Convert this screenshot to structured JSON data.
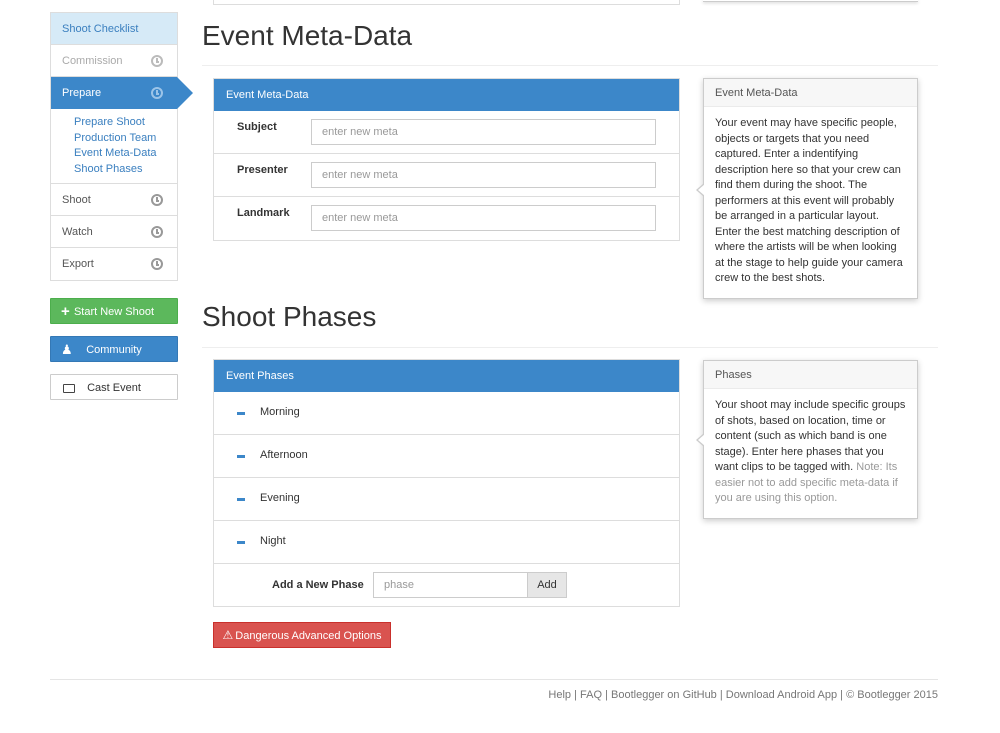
{
  "sidebar": {
    "header": "Shoot Checklist",
    "items": [
      {
        "label": "Commission"
      },
      {
        "label": "Prepare"
      },
      {
        "label": "Shoot"
      },
      {
        "label": "Watch"
      },
      {
        "label": "Export"
      }
    ],
    "subnav": [
      "Prepare Shoot",
      "Production Team",
      "Event Meta-Data",
      "Shoot Phases"
    ],
    "buttons": {
      "start_new_shoot": "Start New Shoot",
      "community": "Community",
      "cast_event": "Cast Event"
    }
  },
  "meta_section": {
    "title": "Event Meta-Data",
    "panel_title": "Event Meta-Data",
    "fields": [
      {
        "label": "Subject",
        "placeholder": "enter new meta"
      },
      {
        "label": "Presenter",
        "placeholder": "enter new meta"
      },
      {
        "label": "Landmark",
        "placeholder": "enter new meta"
      }
    ],
    "help": {
      "title": "Event Meta-Data",
      "body": "Your event may have specific people, objects or targets that you need captured. Enter a indentifying description here so that your crew can find them during the shoot. The performers at this event will probably be arranged in a particular layout. Enter the best matching description of where the artists will be when looking at the stage to help guide your camera crew to the best shots."
    }
  },
  "phases_section": {
    "title": "Shoot Phases",
    "panel_title": "Event Phases",
    "phases": [
      "Morning",
      "Afternoon",
      "Evening",
      "Night"
    ],
    "add_label": "Add a New Phase",
    "add_placeholder": "phase",
    "add_button": "Add",
    "help": {
      "title": "Phases",
      "body": "Your shoot may include specific groups of shots, based on location, time or content (such as which band is one stage). Enter here phases that you want clips to be tagged with.",
      "note": "Note: Its easier not to add specific meta-data if you are using this option."
    }
  },
  "danger_button": "Dangerous Advanced Options",
  "footer": {
    "links": [
      "Help",
      "FAQ",
      "Bootlegger on GitHub",
      "Download Android App"
    ],
    "copyright": "© Bootlegger 2015"
  },
  "colors": {
    "primary": "#3c87c9",
    "success": "#5cb85c",
    "danger": "#d9534f",
    "checklist_header_bg": "#d6eaf7"
  }
}
